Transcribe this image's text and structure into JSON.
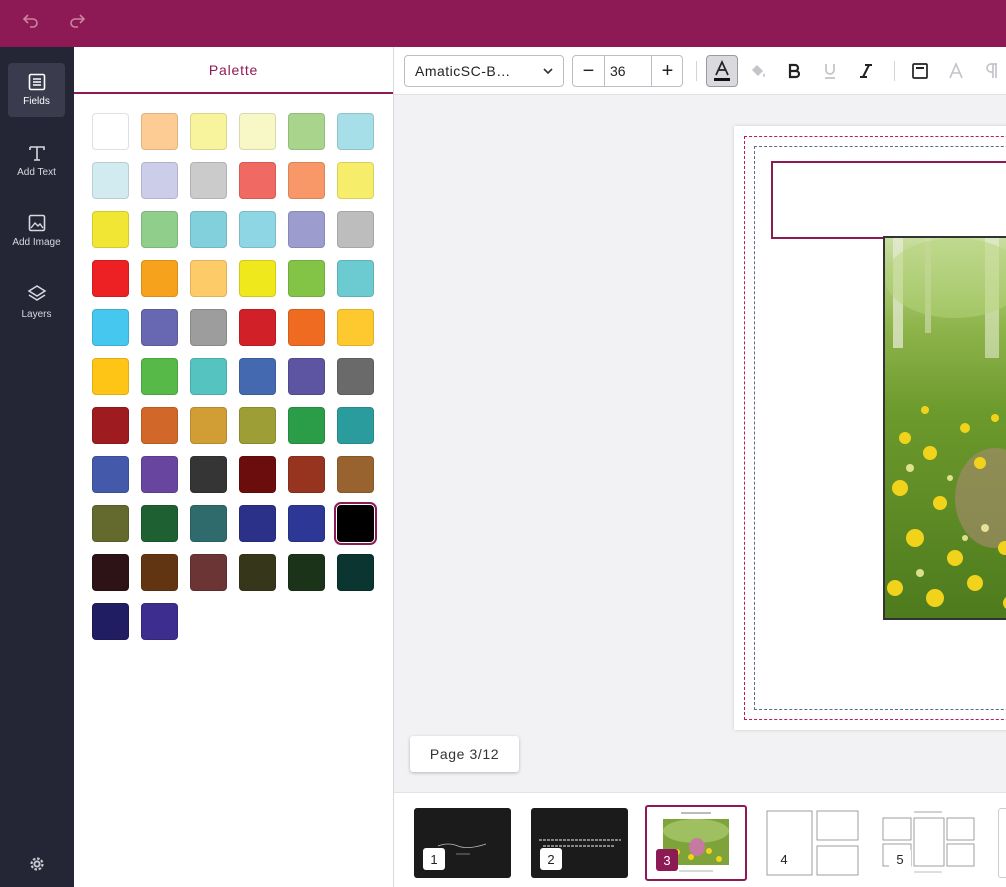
{
  "topbar": {
    "undo_icon": "undo-icon",
    "redo_icon": "redo-icon"
  },
  "rail": {
    "items": [
      {
        "label": "Fields",
        "icon": "fields-icon",
        "active": true
      },
      {
        "label": "Add Text",
        "icon": "text-icon",
        "active": false
      },
      {
        "label": "Add Image",
        "icon": "image-icon",
        "active": false
      },
      {
        "label": "Layers",
        "icon": "layers-icon",
        "active": false
      }
    ],
    "settings_icon": "gear-icon"
  },
  "palette": {
    "title": "Palette",
    "selected_color": "#000000",
    "colors": [
      "#ffffff",
      "#fdcc94",
      "#f8f49e",
      "#f8f8c7",
      "#a8d58b",
      "#a6dfe8",
      "#d2ebf1",
      "#cccde9",
      "#cbcbcb",
      "#f06a63",
      "#f89868",
      "#f6ee6b",
      "#f2e634",
      "#8fce8b",
      "#82d0db",
      "#8ed6e4",
      "#9d9ccf",
      "#bdbdbd",
      "#ed2024",
      "#f7a21c",
      "#fdcc68",
      "#eee81c",
      "#83c446",
      "#6ccbd0",
      "#46c7f0",
      "#6867b1",
      "#9d9d9d",
      "#d12027",
      "#f06b22",
      "#fec92f",
      "#fec517",
      "#57b947",
      "#55c4c1",
      "#4569b1",
      "#5d54a2",
      "#6a6a6a",
      "#9e1b20",
      "#d2672a",
      "#d19d35",
      "#9d9e36",
      "#2b9d48",
      "#2b9c9e",
      "#4559aa",
      "#6846a0",
      "#353535",
      "#6c0d0d",
      "#97341f",
      "#98632f",
      "#646a2e",
      "#1e6031",
      "#2f6b6c",
      "#2b3189",
      "#2d3796",
      "#000000",
      "#2d1216",
      "#623512",
      "#6b3535",
      "#36361a",
      "#1b3319",
      "#0a3531",
      "#211d62",
      "#3c2d8e"
    ]
  },
  "toolbar": {
    "font_name": "AmaticSC-B…",
    "font_size": "36",
    "minus": "−",
    "plus": "+",
    "buttons": [
      {
        "name": "text-color-button",
        "icon": "text-color-icon",
        "active": true,
        "disabled": false
      },
      {
        "name": "fill-color-button",
        "icon": "paint-bucket-icon",
        "active": false,
        "disabled": true
      },
      {
        "name": "bold-button",
        "icon": "bold-icon",
        "active": false,
        "disabled": false
      },
      {
        "name": "underline-button",
        "icon": "underline-icon",
        "active": false,
        "disabled": true
      },
      {
        "name": "italic-button",
        "icon": "italic-icon",
        "active": false,
        "disabled": false
      },
      {
        "name": "align-button",
        "icon": "text-box-icon",
        "active": false,
        "disabled": false
      },
      {
        "name": "outline-button",
        "icon": "outline-text-icon",
        "active": false,
        "disabled": true
      },
      {
        "name": "paragraph-button",
        "icon": "paragraph-icon",
        "active": false,
        "disabled": true
      }
    ]
  },
  "canvas": {
    "page_indicator": "Page 3/12"
  },
  "thumbnails": [
    {
      "number": "1",
      "active": false
    },
    {
      "number": "2",
      "active": false
    },
    {
      "number": "3",
      "active": true
    },
    {
      "number": "4",
      "active": false
    },
    {
      "number": "5",
      "active": false
    }
  ]
}
